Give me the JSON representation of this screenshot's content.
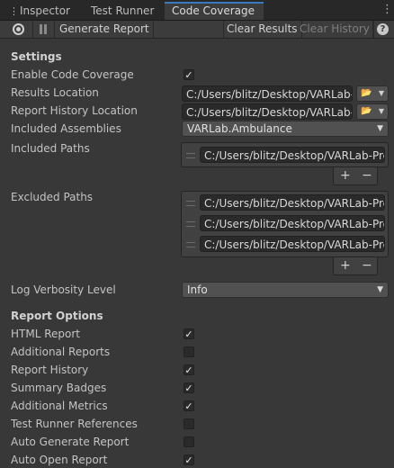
{
  "tabs": [
    {
      "label": "Inspector",
      "icon": "kebab-icon"
    },
    {
      "label": "Test Runner"
    },
    {
      "label": "Code Coverage",
      "active": true
    }
  ],
  "toolbar": {
    "generate_label": "Generate Report",
    "clear_results_label": "Clear Results",
    "clear_history_label": "Clear History"
  },
  "settings": {
    "heading": "Settings",
    "enable_code_coverage": {
      "label": "Enable Code Coverage",
      "checked": true
    },
    "results_location": {
      "label": "Results Location",
      "value": "C:/Users/blitz/Desktop/VARLab-"
    },
    "report_history_location": {
      "label": "Report History Location",
      "value": "C:/Users/blitz/Desktop/VARLab-"
    },
    "included_assemblies": {
      "label": "Included Assemblies",
      "value": "VARLab.Ambulance"
    },
    "included_paths": {
      "label": "Included Paths",
      "items": [
        "C:/Users/blitz/Desktop/VARLab-Prc"
      ]
    },
    "excluded_paths": {
      "label": "Excluded Paths",
      "items": [
        "C:/Users/blitz/Desktop/VARLab-Prc",
        "C:/Users/blitz/Desktop/VARLab-Prc",
        "C:/Users/blitz/Desktop/VARLab-Prc"
      ]
    },
    "log_verbosity": {
      "label": "Log Verbosity Level",
      "value": "Info"
    }
  },
  "report_options": {
    "heading": "Report Options",
    "items": [
      {
        "label": "HTML Report",
        "checked": true
      },
      {
        "label": "Additional Reports",
        "checked": false
      },
      {
        "label": "Report History",
        "checked": true
      },
      {
        "label": "Summary Badges",
        "checked": true
      },
      {
        "label": "Additional Metrics",
        "checked": true
      },
      {
        "label": "Test Runner References",
        "checked": false
      },
      {
        "label": "Auto Generate Report",
        "checked": false
      },
      {
        "label": "Auto Open Report",
        "checked": true
      }
    ]
  },
  "list_controls": {
    "add": "+",
    "remove": "−"
  },
  "checkmark": "✓",
  "colors": {
    "background": "#383838",
    "tab_accent": "#3a79bb",
    "field_bg": "#2a2a2a"
  }
}
